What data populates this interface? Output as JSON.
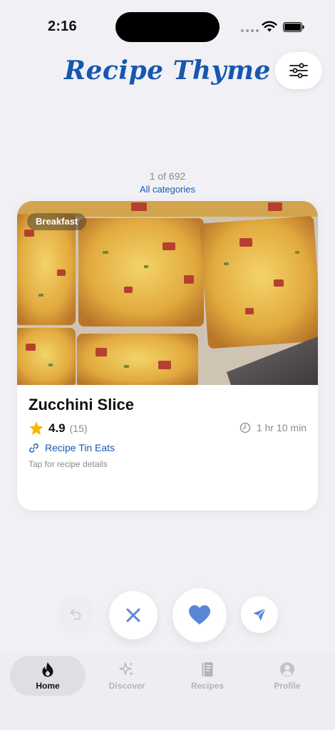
{
  "status_bar": {
    "time": "2:16"
  },
  "header": {
    "app_title": "Recipe Thyme",
    "filter_icon": "sliders-icon"
  },
  "browse": {
    "counter": "1 of 692",
    "category": "All categories"
  },
  "card": {
    "tag": "Breakfast",
    "title": "Zucchini Slice",
    "rating": "4.9",
    "rating_count": "(15)",
    "time": "1 hr 10 min",
    "source": "Recipe Tin Eats",
    "hint": "Tap for recipe details"
  },
  "actions": {
    "undo_icon": "undo-icon",
    "pass_icon": "x-icon",
    "like_icon": "heart-icon",
    "share_icon": "send-icon"
  },
  "tabs": [
    {
      "label": "Home",
      "icon": "flame-icon",
      "active": true
    },
    {
      "label": "Discover",
      "icon": "sparkles-icon",
      "active": false
    },
    {
      "label": "Recipes",
      "icon": "book-icon",
      "active": false
    },
    {
      "label": "Profile",
      "icon": "person-icon",
      "active": false
    }
  ],
  "colors": {
    "accent": "#1857b0",
    "background": "#f1f1f5",
    "star": "#f5b800"
  }
}
